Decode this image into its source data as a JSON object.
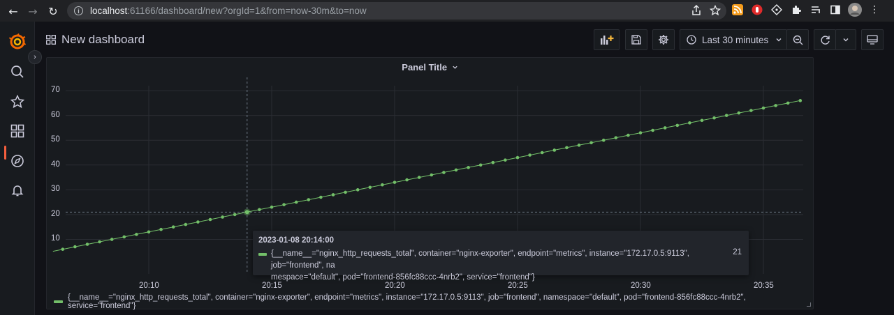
{
  "browser": {
    "url_host": "localhost",
    "url_rest": ":61166/dashboard/new?orgId=1&from=now-30m&to=now"
  },
  "sidebar": {
    "items": [
      {
        "icon": "grafana-logo-icon"
      },
      {
        "icon": "search-icon"
      },
      {
        "icon": "star-icon"
      },
      {
        "icon": "dashboards-icon"
      },
      {
        "icon": "explore-compass-icon"
      },
      {
        "icon": "alerting-bell-icon"
      }
    ]
  },
  "header": {
    "title": "New dashboard",
    "time_range": "Last 30 minutes"
  },
  "panel": {
    "title": "Panel Title",
    "tooltip": {
      "time": "2023-01-08 20:14:00",
      "series_line1": "{__name__=\"nginx_http_requests_total\", container=\"nginx-exporter\", endpoint=\"metrics\", instance=\"172.17.0.5:9113\", job=\"frontend\", na",
      "series_line2": "mespace=\"default\", pod=\"frontend-856fc88ccc-4nrb2\", service=\"frontend\"}",
      "value": "21"
    },
    "legend": "{__name__=\"nginx_http_requests_total\", container=\"nginx-exporter\", endpoint=\"metrics\", instance=\"172.17.0.5:9113\", job=\"frontend\", namespace=\"default\", pod=\"frontend-856fc88ccc-4nrb2\", service=\"frontend\"}"
  },
  "colors": {
    "series": "#73bf69",
    "accent": "#f55f3e"
  },
  "chart_data": {
    "type": "line",
    "title": "Panel Title",
    "xlabel": "",
    "ylabel": "",
    "x_ticks": [
      "20:10",
      "20:15",
      "20:20",
      "20:25",
      "20:30",
      "20:35"
    ],
    "y_ticks": [
      "10",
      "20",
      "30",
      "40",
      "50",
      "60",
      "70"
    ],
    "ylim": [
      0,
      72
    ],
    "x_start": "20:06:30",
    "x_step_seconds": 30,
    "series": [
      {
        "name": "{__name__=\"nginx_http_requests_total\", container=\"nginx-exporter\", endpoint=\"metrics\", instance=\"172.17.0.5:9113\", job=\"frontend\", namespace=\"default\", pod=\"frontend-856fc88ccc-4nrb2\", service=\"frontend\"}",
        "values": [
          6,
          7,
          8,
          9,
          10,
          11,
          12,
          13,
          14,
          15,
          16,
          17,
          18,
          19,
          20,
          21,
          22,
          23,
          24,
          25,
          26,
          27,
          28,
          29,
          30,
          31,
          32,
          33,
          34,
          35,
          36,
          37,
          38,
          39,
          40,
          41,
          42,
          43,
          44,
          45,
          46,
          47,
          48,
          49,
          50,
          51,
          52,
          53,
          54,
          55,
          56,
          57,
          58,
          59,
          60,
          61,
          62,
          63,
          64,
          65,
          66
        ]
      }
    ],
    "hover_time": "20:14:00",
    "hover_value": 21,
    "grid": true,
    "legend": "bottom-left"
  }
}
